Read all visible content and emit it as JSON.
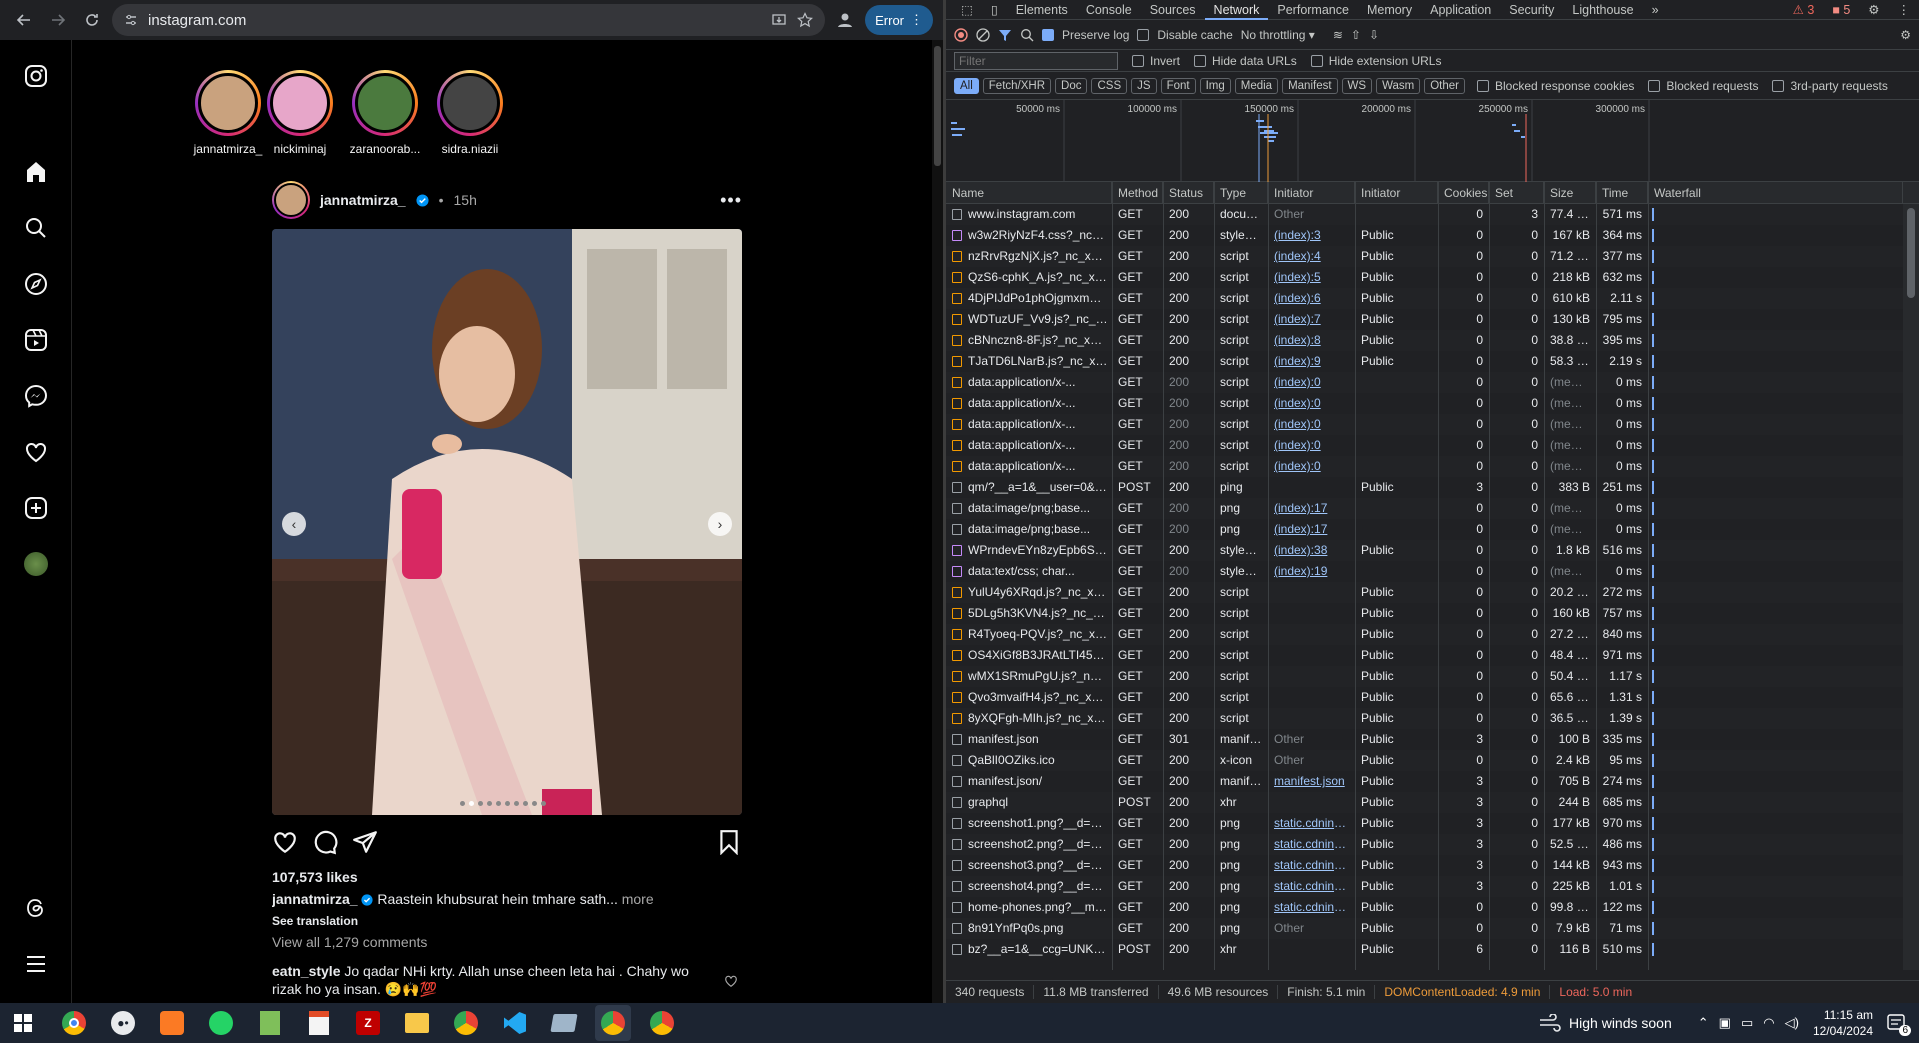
{
  "browser": {
    "url": "instagram.com",
    "error_label": "Error"
  },
  "instagram": {
    "stories": [
      {
        "name": "jannatmirza_",
        "color": "#c9a27e"
      },
      {
        "name": "nickiminaj",
        "color": "#e7a6c9"
      },
      {
        "name": "zaranoorab...",
        "color": "#4b7a3e"
      },
      {
        "name": "sidra.niazii",
        "color": "#444444"
      }
    ],
    "post": {
      "author": "jannatmirza_",
      "age": "15h",
      "separator": "•",
      "likes": "107,573 likes",
      "caption_author": "jannatmirza_",
      "caption": "Raastein khubsurat hein tmhare sath...",
      "more": "more",
      "see_translation": "See translation",
      "view_comments": "View all 1,279 comments",
      "comment_author": "eatn_style",
      "comment_text": "Jo qadar NHi krty. Allah unse cheen leta hai . Chahy wo rizak ho ya insan. 😢🙌💯"
    }
  },
  "devtools": {
    "tabs": [
      "Elements",
      "Console",
      "Sources",
      "Network",
      "Performance",
      "Memory",
      "Application",
      "Security",
      "Lighthouse"
    ],
    "active_tab": "Network",
    "warnings": "3",
    "errors": "5",
    "toolbar": {
      "preserve_log": "Preserve log",
      "disable_cache": "Disable cache",
      "throttling": "No throttling"
    },
    "filter_placeholder": "Filter",
    "filter_options": [
      "Invert",
      "Hide data URLs",
      "Hide extension URLs"
    ],
    "type_chips": [
      "All",
      "Fetch/XHR",
      "Doc",
      "CSS",
      "JS",
      "Font",
      "Img",
      "Media",
      "Manifest",
      "WS",
      "Wasm",
      "Other"
    ],
    "extra_filters": [
      "Blocked response cookies",
      "Blocked requests",
      "3rd-party requests"
    ],
    "timeline_ticks": [
      "50000 ms",
      "100000 ms",
      "150000 ms",
      "200000 ms",
      "250000 ms",
      "300000 ms"
    ],
    "columns": [
      "Name",
      "Method",
      "Status",
      "Type",
      "Initiator",
      "Initiator Addres...",
      "Cookies",
      "Set Coo...",
      "Size",
      "Time",
      "Waterfall"
    ],
    "requests": [
      [
        "www.instagram.com",
        "GET",
        "200",
        "document",
        "Other",
        "",
        "0",
        "3",
        "77.4 kB",
        "571 ms"
      ],
      [
        "w3w2RiyNzF4.css?_nc_x=Ij3Wp8...",
        "GET",
        "200",
        "stylesheet",
        "(index):3",
        "Public",
        "0",
        "0",
        "167 kB",
        "364 ms"
      ],
      [
        "nzRrvRgzNjX.js?_nc_x=Ij3Wp8lg...",
        "GET",
        "200",
        "script",
        "(index):4",
        "Public",
        "0",
        "0",
        "71.2 kB",
        "377 ms"
      ],
      [
        "QzS6-cphK_A.js?_nc_x=Ij3Wp8lg...",
        "GET",
        "200",
        "script",
        "(index):5",
        "Public",
        "0",
        "0",
        "218 kB",
        "632 ms"
      ],
      [
        "4DjPIJdPo1phOjgmxmSmbJcFQ...",
        "GET",
        "200",
        "script",
        "(index):6",
        "Public",
        "0",
        "0",
        "610 kB",
        "2.11 s"
      ],
      [
        "WDTuzUF_Vv9.js?_nc_x=Ij3Wp8l...",
        "GET",
        "200",
        "script",
        "(index):7",
        "Public",
        "0",
        "0",
        "130 kB",
        "795 ms"
      ],
      [
        "cBNnczn8-8F.js?_nc_x=Ij3Wp8lg...",
        "GET",
        "200",
        "script",
        "(index):8",
        "Public",
        "0",
        "0",
        "38.8 kB",
        "395 ms"
      ],
      [
        "TJaTD6LNarB.js?_nc_x=Ij3Wp8lg...",
        "GET",
        "200",
        "script",
        "(index):9",
        "Public",
        "0",
        "0",
        "58.3 kB",
        "2.19 s"
      ],
      [
        "data:application/x-...",
        "GET",
        "200",
        "script",
        "(index):0",
        "",
        "0",
        "0",
        "(mem...",
        "0 ms"
      ],
      [
        "data:application/x-...",
        "GET",
        "200",
        "script",
        "(index):0",
        "",
        "0",
        "0",
        "(mem...",
        "0 ms"
      ],
      [
        "data:application/x-...",
        "GET",
        "200",
        "script",
        "(index):0",
        "",
        "0",
        "0",
        "(mem...",
        "0 ms"
      ],
      [
        "data:application/x-...",
        "GET",
        "200",
        "script",
        "(index):0",
        "",
        "0",
        "0",
        "(mem...",
        "0 ms"
      ],
      [
        "data:application/x-...",
        "GET",
        "200",
        "script",
        "(index):0",
        "",
        "0",
        "0",
        "(mem...",
        "0 ms"
      ],
      [
        "qm/?__a=1&__user=0&__comet_...",
        "POST",
        "200",
        "ping",
        "",
        "Public",
        "3",
        "0",
        "383 B",
        "251 ms"
      ],
      [
        "data:image/png;base...",
        "GET",
        "200",
        "png",
        "(index):17",
        "",
        "0",
        "0",
        "(mem...",
        "0 ms"
      ],
      [
        "data:image/png;base...",
        "GET",
        "200",
        "png",
        "(index):17",
        "",
        "0",
        "0",
        "(mem...",
        "0 ms"
      ],
      [
        "WPrndevEYn8zyEpb6SJKFF.css?_...",
        "GET",
        "200",
        "stylesheet",
        "(index):38",
        "Public",
        "0",
        "0",
        "1.8 kB",
        "516 ms"
      ],
      [
        "data:text/css; char...",
        "GET",
        "200",
        "stylesheet",
        "(index):19",
        "",
        "0",
        "0",
        "(mem...",
        "0 ms"
      ],
      [
        "YulU4y6XRqd.js?_nc_x=Ij3Wp8lg...",
        "GET",
        "200",
        "script",
        "",
        "Public",
        "0",
        "0",
        "20.2 kB",
        "272 ms"
      ],
      [
        "5DLg5h3KVN4.js?_nc_x=Ij3Wp8l...",
        "GET",
        "200",
        "script",
        "",
        "Public",
        "0",
        "0",
        "160 kB",
        "757 ms"
      ],
      [
        "R4Tyoeq-PQV.js?_nc_x=Ij3Wp8lg...",
        "GET",
        "200",
        "script",
        "",
        "Public",
        "0",
        "0",
        "27.2 kB",
        "840 ms"
      ],
      [
        "OS4XiGf8B3JRAtLTI45A93Szy3Q...",
        "GET",
        "200",
        "script",
        "",
        "Public",
        "0",
        "0",
        "48.4 kB",
        "971 ms"
      ],
      [
        "wMX1SRmuPgU.js?_nc_x=Ij3Wp...",
        "GET",
        "200",
        "script",
        "",
        "Public",
        "0",
        "0",
        "50.4 kB",
        "1.17 s"
      ],
      [
        "Qvo3mvaifH4.js?_nc_x=Ij3Wp8lg...",
        "GET",
        "200",
        "script",
        "",
        "Public",
        "0",
        "0",
        "65.6 kB",
        "1.31 s"
      ],
      [
        "8yXQFgh-MIh.js?_nc_x=Ij3Wp8l...",
        "GET",
        "200",
        "script",
        "",
        "Public",
        "0",
        "0",
        "36.5 kB",
        "1.39 s"
      ],
      [
        "manifest.json",
        "GET",
        "301",
        "manifes...",
        "Other",
        "Public",
        "3",
        "0",
        "100 B",
        "335 ms"
      ],
      [
        "QaBlI0OZiks.ico",
        "GET",
        "200",
        "x-icon",
        "Other",
        "Public",
        "0",
        "0",
        "2.4 kB",
        "95 ms"
      ],
      [
        "manifest.json/",
        "GET",
        "200",
        "manifest",
        "manifest.json",
        "Public",
        "3",
        "0",
        "705 B",
        "274 ms"
      ],
      [
        "graphql",
        "POST",
        "200",
        "xhr",
        "",
        "Public",
        "3",
        "0",
        "244 B",
        "685 ms"
      ],
      [
        "screenshot1.png?__d=www",
        "GET",
        "200",
        "png",
        "static.cdninstagr...",
        "Public",
        "3",
        "0",
        "177 kB",
        "970 ms"
      ],
      [
        "screenshot2.png?__d=www",
        "GET",
        "200",
        "png",
        "static.cdninstagr...",
        "Public",
        "3",
        "0",
        "52.5 kB",
        "486 ms"
      ],
      [
        "screenshot3.png?__d=www",
        "GET",
        "200",
        "png",
        "static.cdninstagr...",
        "Public",
        "3",
        "0",
        "144 kB",
        "943 ms"
      ],
      [
        "screenshot4.png?__d=www",
        "GET",
        "200",
        "png",
        "static.cdninstagr...",
        "Public",
        "3",
        "0",
        "225 kB",
        "1.01 s"
      ],
      [
        "home-phones.png?__makehaste...",
        "GET",
        "200",
        "png",
        "static.cdninstagr...",
        "Public",
        "0",
        "0",
        "99.8 kB",
        "122 ms"
      ],
      [
        "8n91YnfPq0s.png",
        "GET",
        "200",
        "png",
        "Other",
        "Public",
        "0",
        "0",
        "7.9 kB",
        "71 ms"
      ],
      [
        "bz?__a=1&__ccg=UNKNOWN&__...",
        "POST",
        "200",
        "xhr",
        "",
        "Public",
        "6",
        "0",
        "116 B",
        "510 ms"
      ]
    ],
    "status_bar": {
      "requests": "340 requests",
      "transferred": "11.8 MB transferred",
      "resources": "49.6 MB resources",
      "finish": "Finish: 5.1 min",
      "dom_content_loaded": "DOMContentLoaded: 4.9 min",
      "load": "Load: 5.0 min"
    }
  },
  "taskbar": {
    "weather": "High winds soon",
    "time": "11:15 am",
    "date": "12/04/2024",
    "notifications": "6"
  },
  "colors": {
    "dom_loaded": "#ed9b3a",
    "load": "#ee675c",
    "accent": "#7cacf8",
    "ig_verified": "#0095f6"
  }
}
